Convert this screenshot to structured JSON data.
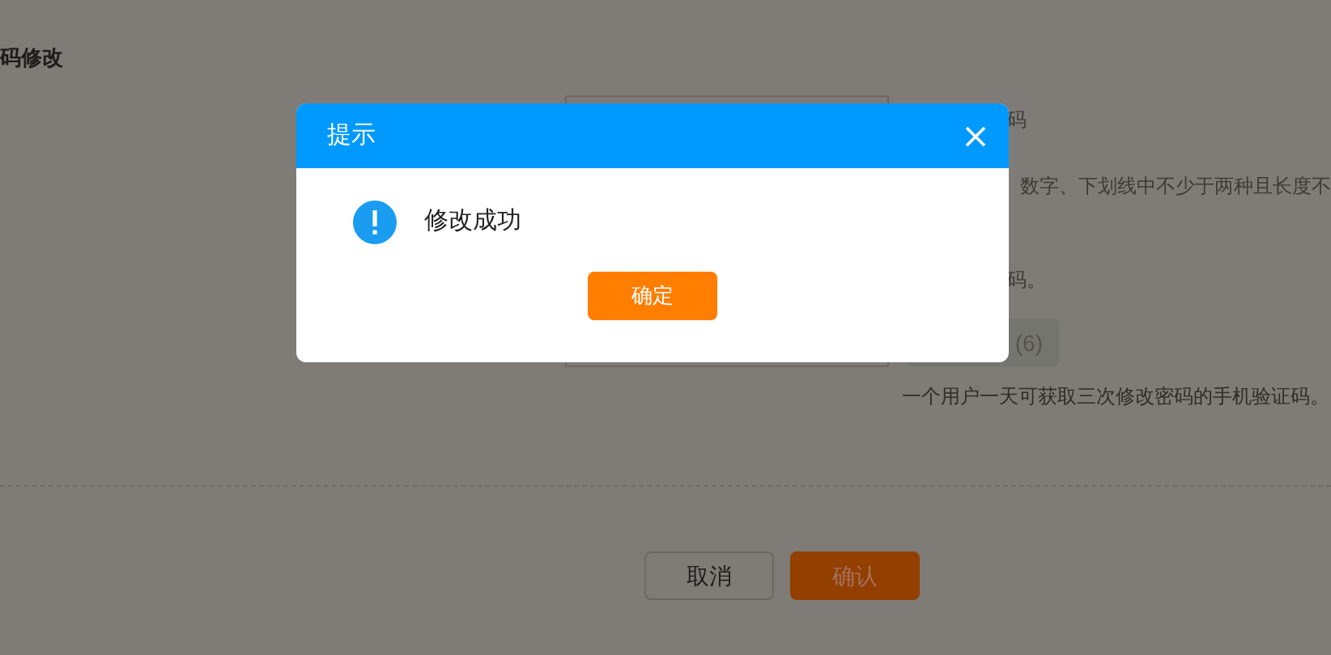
{
  "page": {
    "title": "码修改",
    "hints": [
      "码",
      "数字、下划线中不少于两种且长度不",
      "码。"
    ],
    "code_button": "(6)",
    "sms_note": "一个用户一天可获取三次修改密码的手机验证码。",
    "buttons": [
      {
        "label": "取消",
        "kind": "secondary"
      },
      {
        "label": "确认",
        "kind": "primary"
      }
    ]
  },
  "dialog": {
    "title": "提示",
    "message": "修改成功",
    "button": "确定"
  }
}
